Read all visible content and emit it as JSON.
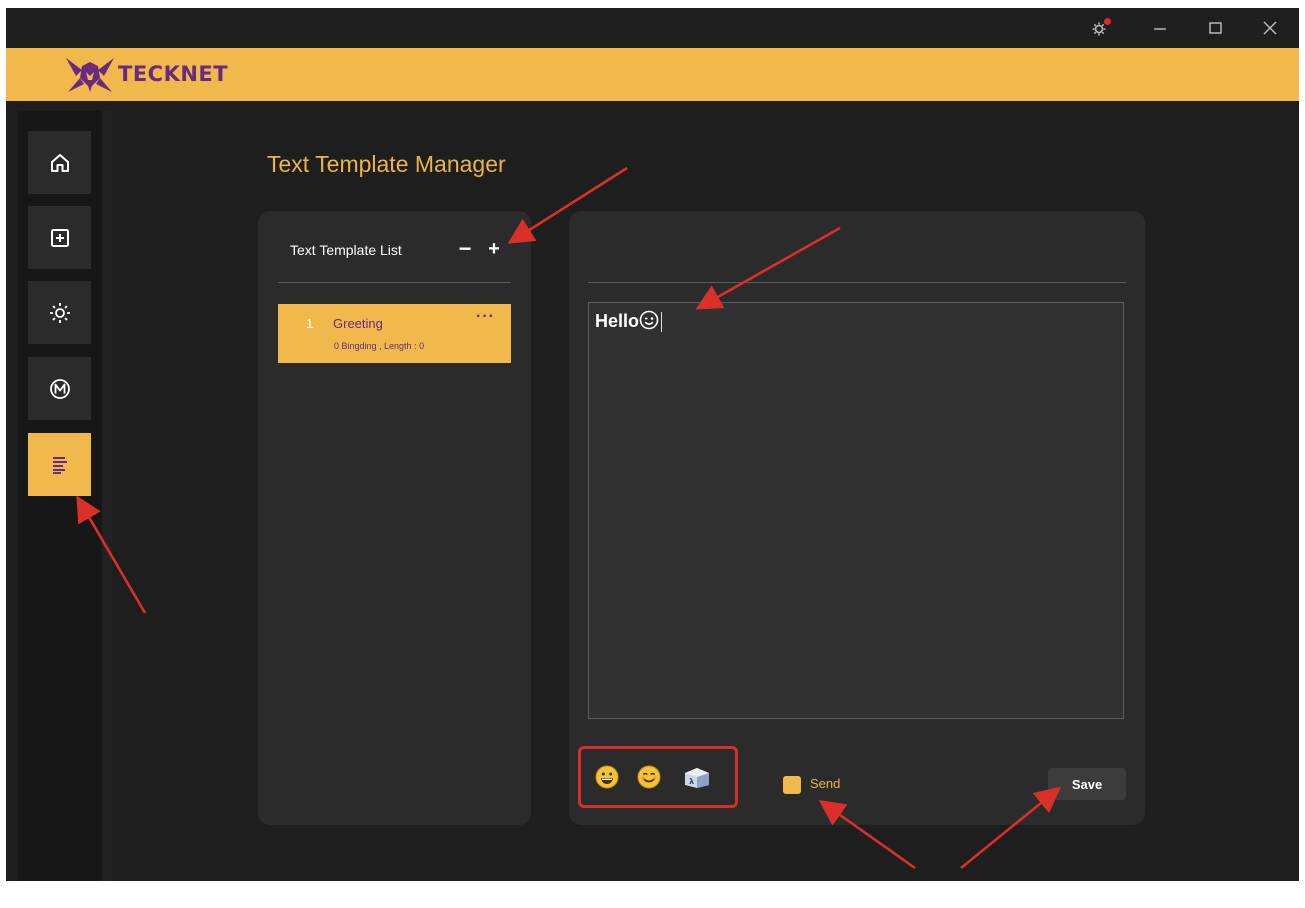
{
  "app": {
    "brand": "TECKNET"
  },
  "page": {
    "title": "Text Template Manager"
  },
  "template_list": {
    "header": "Text Template List",
    "remove_label": "−",
    "add_label": "+",
    "items": [
      {
        "index": "1",
        "name": "Greeting",
        "meta": "0 Bingding  ,  Length : 0",
        "more": "···"
      }
    ]
  },
  "editor": {
    "text": "Hello"
  },
  "footer": {
    "send_label": "Send",
    "save_label": "Save"
  },
  "colors": {
    "accent": "#f1b94b",
    "brand_purple": "#6a2a80",
    "background": "#1e1e1e",
    "panel": "#2b2b2b",
    "annotation": "#d32f2f"
  }
}
